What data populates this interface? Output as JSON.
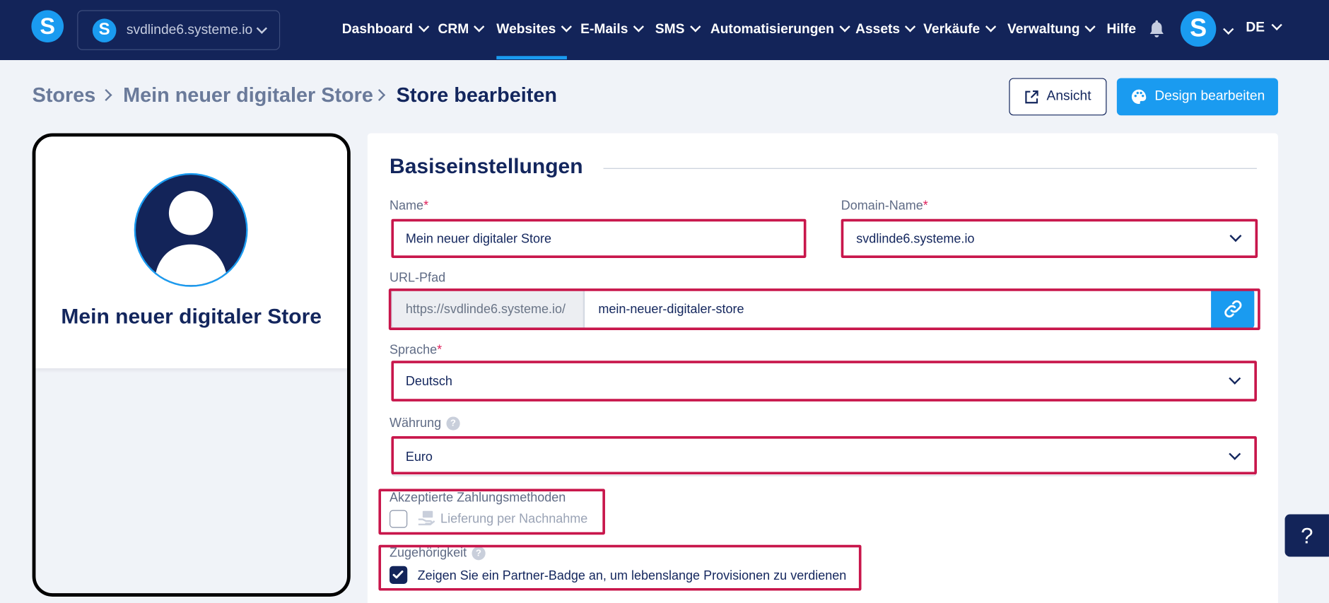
{
  "brand": {
    "logo_letter": "S",
    "accent": "#1a9bf0",
    "navy": "#132459",
    "highlight": "#c8164b"
  },
  "domain_switcher": {
    "letter": "S",
    "domain": "svdlinde6.systeme.io"
  },
  "nav": {
    "items": [
      {
        "label": "Dashboard"
      },
      {
        "label": "CRM"
      },
      {
        "label": "Websites"
      },
      {
        "label": "E-Mails"
      },
      {
        "label": "SMS"
      },
      {
        "label": "Automatisierungen"
      },
      {
        "label": "Assets"
      },
      {
        "label": "Verkäufe"
      },
      {
        "label": "Verwaltung"
      },
      {
        "label": "Hilfe"
      }
    ],
    "active": "Websites",
    "avatar_letter": "S",
    "language": "DE"
  },
  "breadcrumb": {
    "items": [
      "Stores",
      "Mein neuer digitaler Store",
      "Store bearbeiten"
    ]
  },
  "actions": {
    "view_label": "Ansicht",
    "design_label": "Design bearbeiten"
  },
  "preview": {
    "store_name": "Mein neuer digitaler Store"
  },
  "form": {
    "section_title": "Basiseinstellungen",
    "name": {
      "label": "Name",
      "required": "*",
      "value": "Mein neuer digitaler Store"
    },
    "domain": {
      "label": "Domain-Name",
      "required": "*",
      "value": "svdlinde6.systeme.io"
    },
    "url_path": {
      "label": "URL-Pfad",
      "prefix": "https://svdlinde6.systeme.io/",
      "value": "mein-neuer-digitaler-store"
    },
    "language": {
      "label": "Sprache",
      "required": "*",
      "value": "Deutsch"
    },
    "currency": {
      "label": "Währung",
      "help": "?",
      "value": "Euro"
    },
    "payment": {
      "label": "Akzeptierte Zahlungsmethoden",
      "option": "Lieferung per Nachnahme",
      "checked": false
    },
    "affiliation": {
      "label": "Zugehörigkeit",
      "help": "?",
      "option": "Zeigen Sie ein Partner-Badge an, um lebenslange Provisionen zu verdienen",
      "checked": true
    }
  },
  "help_button": "?"
}
